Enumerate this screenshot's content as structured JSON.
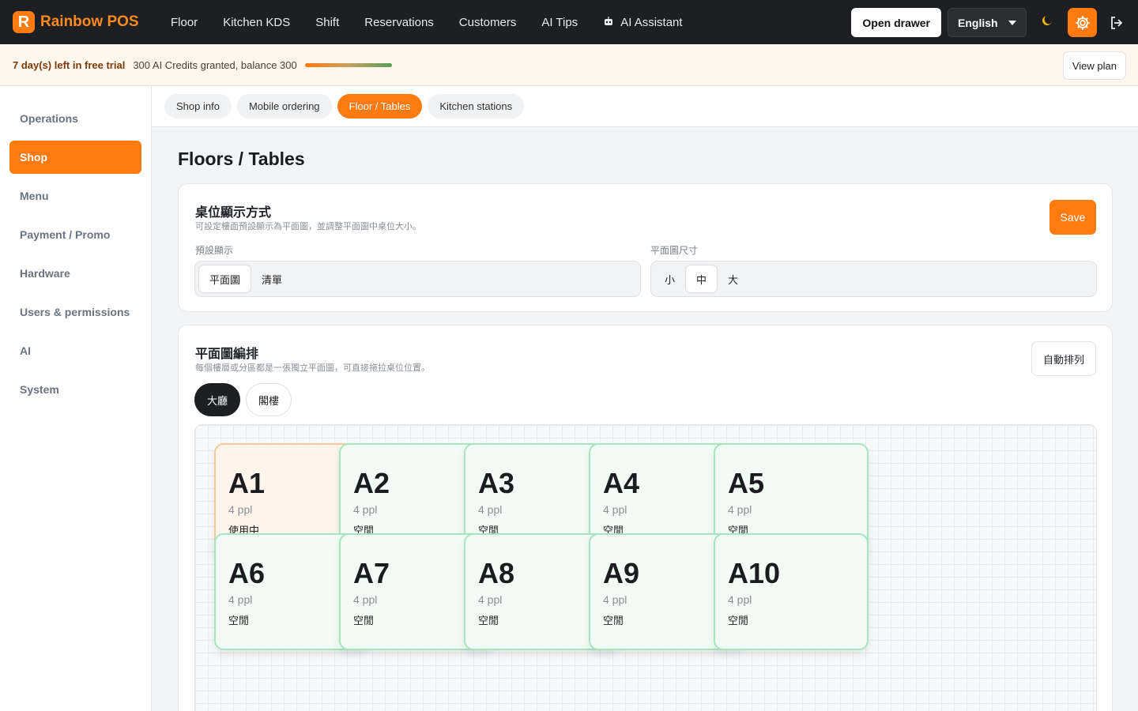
{
  "brand": {
    "name": "Rainbow POS",
    "logo_letter": "R",
    "accent": "#ff7a0f"
  },
  "nav": [
    {
      "label": "Floor"
    },
    {
      "label": "Kitchen KDS"
    },
    {
      "label": "Shift"
    },
    {
      "label": "Reservations"
    },
    {
      "label": "Customers"
    },
    {
      "label": "AI Tips"
    },
    {
      "label": "AI Assistant",
      "icon": "robot-icon"
    }
  ],
  "top_right": {
    "open_drawer": "Open drawer",
    "language": "English"
  },
  "trial": {
    "days_left": "7 day(s) left in free trial",
    "credits": "300 AI Credits granted, balance 300",
    "view_plan": "View plan"
  },
  "sidebar": [
    {
      "label": "Operations"
    },
    {
      "label": "Shop",
      "active": true
    },
    {
      "label": "Menu"
    },
    {
      "label": "Payment / Promo"
    },
    {
      "label": "Hardware"
    },
    {
      "label": "Users & permissions"
    },
    {
      "label": "AI"
    },
    {
      "label": "System"
    }
  ],
  "tabs": [
    {
      "label": "Shop info"
    },
    {
      "label": "Mobile ordering"
    },
    {
      "label": "Floor / Tables",
      "active": true
    },
    {
      "label": "Kitchen stations"
    }
  ],
  "page": {
    "title": "Floors / Tables"
  },
  "display_card": {
    "title": "桌位顯示方式",
    "subtitle": "可設定樓面預設顯示為平面圖，並調整平面圖中桌位大小。",
    "save": "Save",
    "default_label": "預設顯示",
    "default_options": [
      "平面圖",
      "清單"
    ],
    "default_selected": "平面圖",
    "size_label": "平面圖尺寸",
    "size_options": [
      "小",
      "中",
      "大"
    ],
    "size_selected": "中"
  },
  "layout_card": {
    "title": "平面圖編排",
    "subtitle": "每個樓層或分區都是一張獨立平面圖，可直接拖拉桌位位置。",
    "auto_arrange": "自動排列",
    "floors": [
      "大廳",
      "閣樓"
    ],
    "active_floor": "大廳"
  },
  "tables": [
    {
      "name": "A1",
      "ppl": "4 ppl",
      "status": "使用中",
      "busy": true
    },
    {
      "name": "A2",
      "ppl": "4 ppl",
      "status": "空閒"
    },
    {
      "name": "A3",
      "ppl": "4 ppl",
      "status": "空閒"
    },
    {
      "name": "A4",
      "ppl": "4 ppl",
      "status": "空閒"
    },
    {
      "name": "A5",
      "ppl": "4 ppl",
      "status": "空閒"
    },
    {
      "name": "A6",
      "ppl": "4 ppl",
      "status": "空閒"
    },
    {
      "name": "A7",
      "ppl": "4 ppl",
      "status": "空閒"
    },
    {
      "name": "A8",
      "ppl": "4 ppl",
      "status": "空閒"
    },
    {
      "name": "A9",
      "ppl": "4 ppl",
      "status": "空閒"
    },
    {
      "name": "A10",
      "ppl": "4 ppl",
      "status": "空閒"
    }
  ]
}
